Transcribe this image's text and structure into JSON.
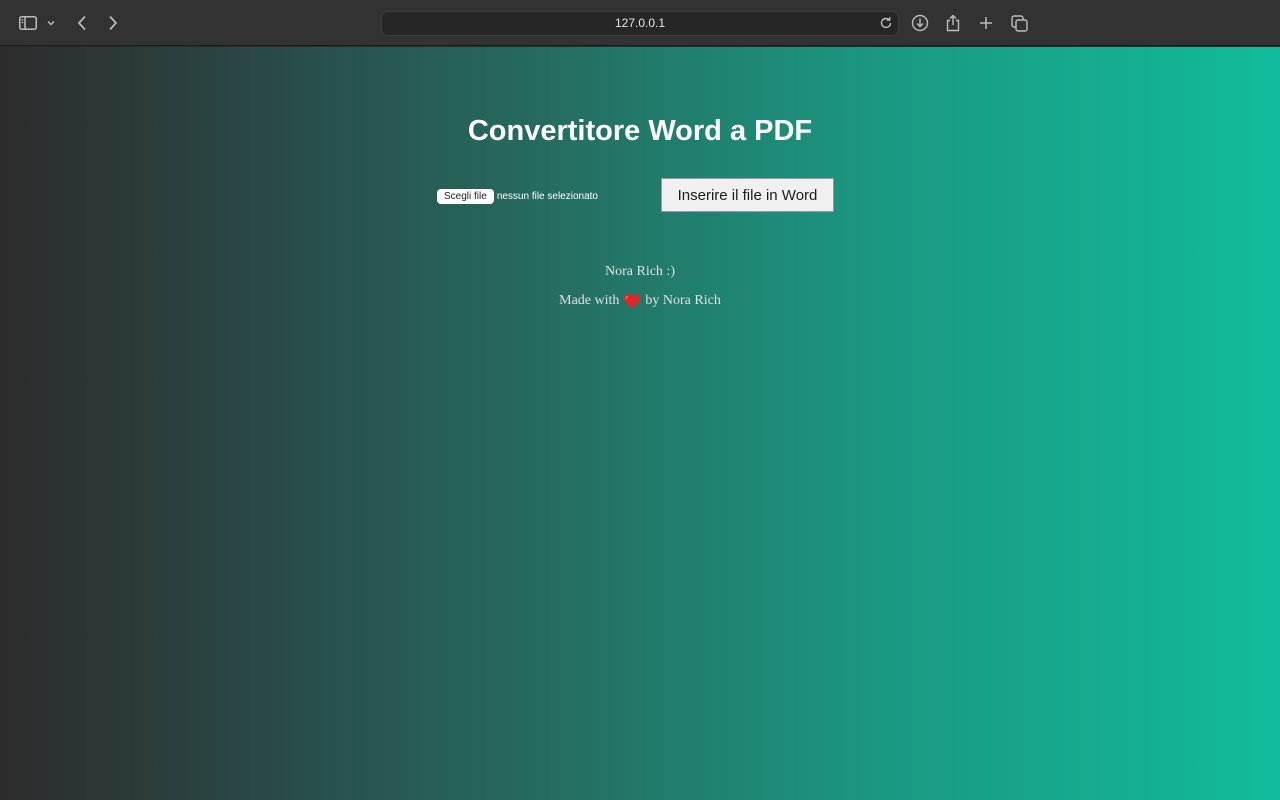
{
  "browser": {
    "url": "127.0.0.1",
    "icons": [
      "sidebar-icon",
      "chevron-down-icon",
      "back-icon",
      "forward-icon",
      "reload-icon",
      "download-icon",
      "share-icon",
      "plus-icon",
      "tabs-icon"
    ]
  },
  "main": {
    "title": "Convertitore Word a PDF",
    "file_input": {
      "button_label": "Scegli file",
      "status": "nessun file selezionato"
    },
    "submit_label": "Inserire il file in Word"
  },
  "footer": {
    "name_line": "Nora Rich :)",
    "made_prefix": "Made with",
    "made_suffix": "by Nora Rich",
    "heart_icon": "heart-icon"
  },
  "colors": {
    "gradient_start": "#2c2c2c",
    "gradient_end": "#11bb9c",
    "heart": "#e0262b"
  }
}
